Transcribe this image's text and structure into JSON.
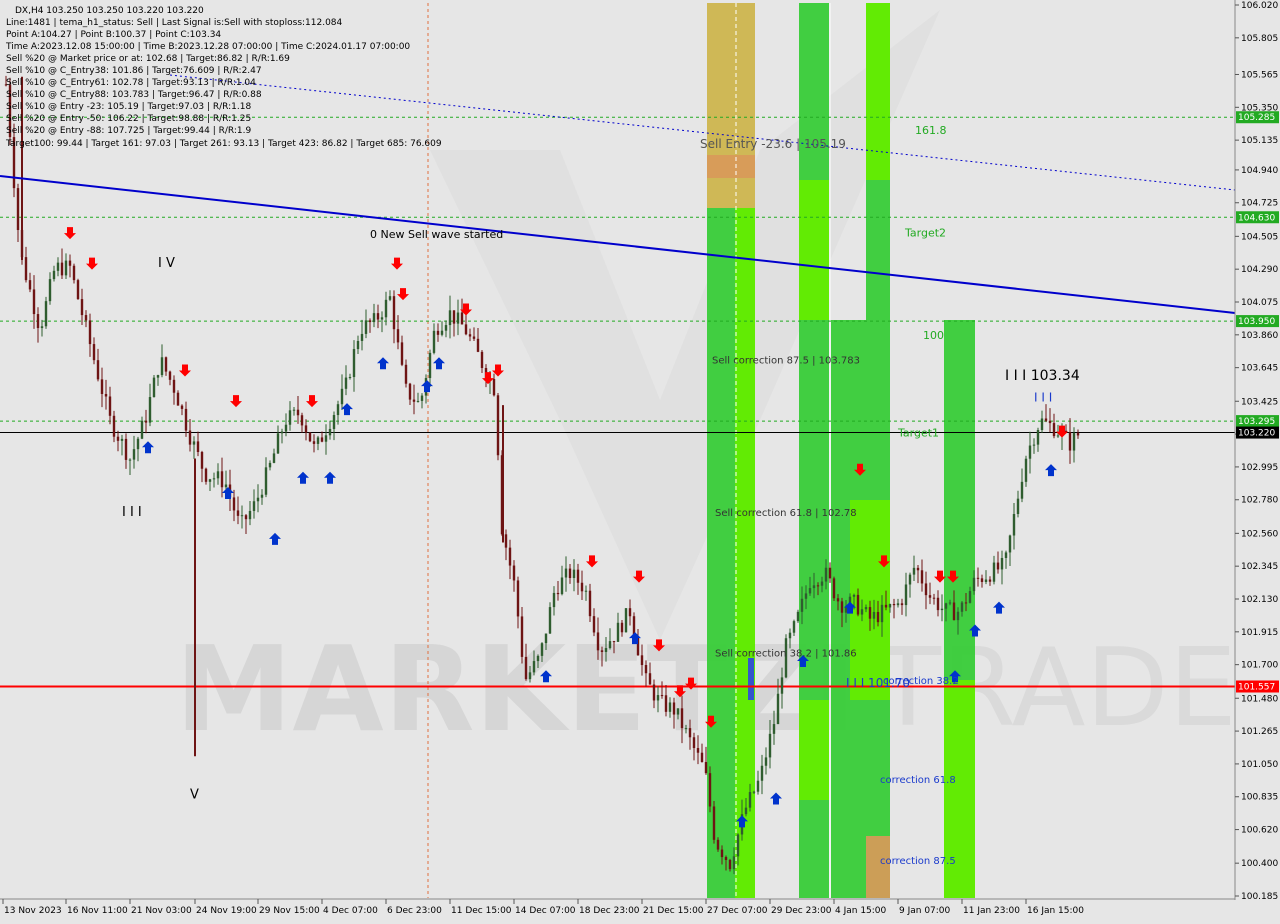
{
  "header": {
    "lines": [
      "DX,H4  103.250 103.250 103.220 103.220",
      "Line:1481  | tema_h1_status: Sell  | Last Signal is:Sell with stoploss:112.084",
      "Point A:104.27  | Point B:100.37  | Point C:103.34",
      "Time A:2023.12.08 15:00:00  | Time B:2023.12.28 07:00:00  | Time C:2024.01.17 07:00:00",
      "Sell %20 @ Market price or at: 102.68  | Target:86.82  | R/R:1.69",
      "Sell %10 @ C_Entry38: 101.86  | Target:76.609  | R/R:2.47",
      "Sell %10 @ C_Entry61: 102.78  | Target:93.13  | R/R:1.04",
      "Sell %10 @ C_Entry88: 103.783  | Target:96.47  | R/R:0.88",
      "Sell %10 @ Entry -23: 105.19  | Target:97.03  | R/R:1.18",
      "Sell %20 @ Entry -50: 106.22  | Target:98.88  | R/R:1.25",
      "Sell %20 @ Entry -88: 107.725  | Target:99.44  | R/R:1.9",
      "Target100: 99.44  | Target 161: 97.03  | Target 261: 93.13  | Target 423: 86.82  | Target 685: 76.609"
    ]
  },
  "watermark": {
    "left": "MARKETZI",
    "right": "TRADE"
  },
  "colors": {
    "background": "#e6e6e6",
    "bull_candle": "#2f5d2f",
    "bear_candle": "#6e1414",
    "green_zone": "#33cc33",
    "lime_zone": "#66ee00",
    "khaki_zone": "#cdb44a",
    "orange_zone": "#d99a5a",
    "trend_line": "#0000cc",
    "red_level": "#ff0000",
    "green_level": "#22aa22",
    "sell_arrow": "#ff0000",
    "buy_arrow": "#0033cc"
  },
  "chart_data": {
    "type": "candlestick",
    "symbol": "DX",
    "timeframe": "H4",
    "ylim": [
      100.185,
      106.02
    ],
    "y_ticks": [
      "106.020",
      "105.805",
      "105.565",
      "105.350",
      "105.135",
      "104.940",
      "104.725",
      "104.505",
      "104.290",
      "104.075",
      "103.860",
      "103.645",
      "103.425",
      "103.210",
      "102.995",
      "102.780",
      "102.560",
      "102.345",
      "102.130",
      "101.915",
      "101.700",
      "101.480",
      "101.265",
      "101.050",
      "100.835",
      "100.620",
      "100.400",
      "100.185"
    ],
    "x_ticks": [
      "13 Nov 2023",
      "16 Nov 11:00",
      "21 Nov 03:00",
      "24 Nov 19:00",
      "29 Nov 15:00",
      "4 Dec 07:00",
      "6 Dec 23:00",
      "11 Dec 15:00",
      "14 Dec 07:00",
      "18 Dec 23:00",
      "21 Dec 15:00",
      "27 Dec 07:00",
      "29 Dec 23:00",
      "4 Jan 15:00",
      "9 Jan 07:00",
      "11 Jan 23:00",
      "16 Jan 15:00"
    ],
    "current_price": {
      "value": 103.22,
      "label": "103.220"
    },
    "horizontal_levels": [
      {
        "value": 105.285,
        "label": "105.285",
        "kind": "dashed-green"
      },
      {
        "value": 104.63,
        "label": "104.630",
        "kind": "dashed-green"
      },
      {
        "value": 103.95,
        "label": "103.950",
        "kind": "dashed-green"
      },
      {
        "value": 103.295,
        "label": "103.295",
        "kind": "dashed-green"
      },
      {
        "value": 101.557,
        "label": "101.557",
        "kind": "solid-red"
      }
    ],
    "level_text": [
      {
        "text": "161.8",
        "value": 105.2
      },
      {
        "text": "Target2",
        "value": 104.53
      },
      {
        "text": "100",
        "value": 103.86
      },
      {
        "text": "Target1",
        "value": 103.22
      }
    ],
    "zone_text": [
      {
        "text": "Sell Entry -23.6 | 105.19",
        "value": 105.11
      },
      {
        "text": "Sell correction 87.5 | 103.783",
        "value": 103.7
      },
      {
        "text": "Sell correction 61.8 | 102.78",
        "value": 102.7
      },
      {
        "text": "Sell correction 38.2 | 101.86",
        "value": 101.78
      },
      {
        "text": "correction 38.2",
        "value": 101.6
      },
      {
        "text": "correction 61.8",
        "value": 100.95
      },
      {
        "text": "correction 87.5",
        "value": 100.42
      }
    ],
    "wave_labels": [
      {
        "text": "0 New Sell wave started",
        "value": 104.52
      },
      {
        "text": "I V",
        "value": 104.33
      },
      {
        "text": "I I I",
        "value": 102.7
      },
      {
        "text": "V",
        "value": 100.85
      },
      {
        "text": "I I I 103.34",
        "value": 103.59
      },
      {
        "text": "I I I",
        "value": 103.45
      },
      {
        "text": "I I  I  101.70",
        "value": 101.58
      }
    ]
  }
}
